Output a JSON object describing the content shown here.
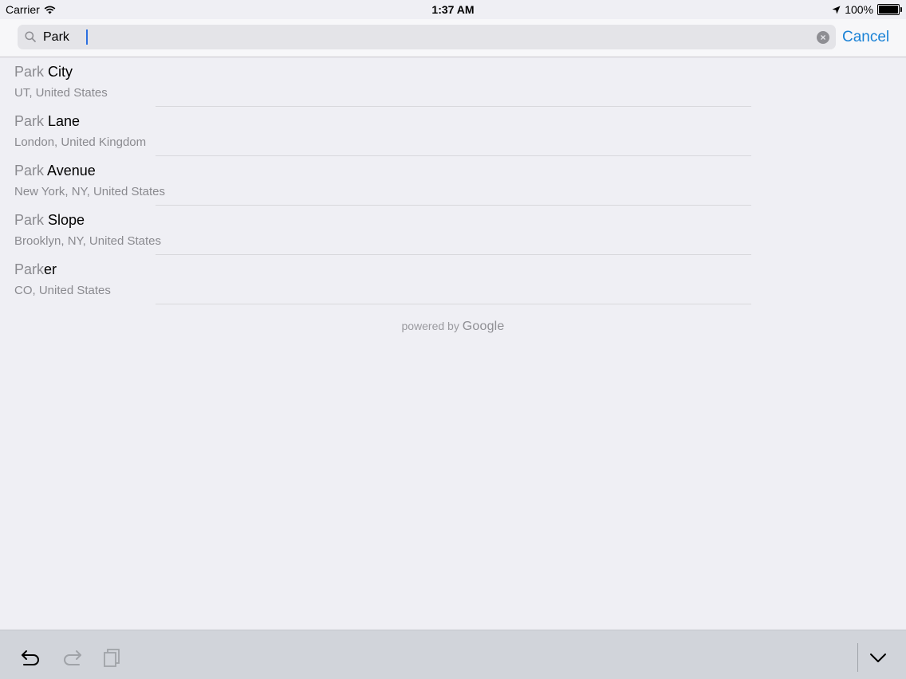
{
  "status_bar": {
    "carrier": "Carrier",
    "time": "1:37 AM",
    "battery": "100%",
    "battery_level": 1.0
  },
  "search": {
    "value": "Park",
    "cancel_label": "Cancel",
    "icons": {
      "search": "magnifying-glass-icon",
      "clear": "clear-x-icon"
    }
  },
  "results": [
    {
      "match": "Park",
      "rest": " City",
      "subtitle": "UT, United States"
    },
    {
      "match": "Park",
      "rest": " Lane",
      "subtitle": "London, United Kingdom"
    },
    {
      "match": "Park",
      "rest": " Avenue",
      "subtitle": "New York, NY, United States"
    },
    {
      "match": "Park",
      "rest": " Slope",
      "subtitle": "Brooklyn, NY, United States"
    },
    {
      "match": "Park",
      "rest": "er",
      "subtitle": "CO, United States"
    }
  ],
  "attribution": {
    "powered_by": "powered by",
    "brand": "Google"
  },
  "keyboard_toolbar": {
    "icons": [
      "undo-icon",
      "redo-icon",
      "paste-icon",
      "dismiss-keyboard-icon"
    ]
  },
  "colors": {
    "accent": "#1a82d6",
    "background": "#efeff4",
    "secondary_text": "#8a8a8f"
  }
}
